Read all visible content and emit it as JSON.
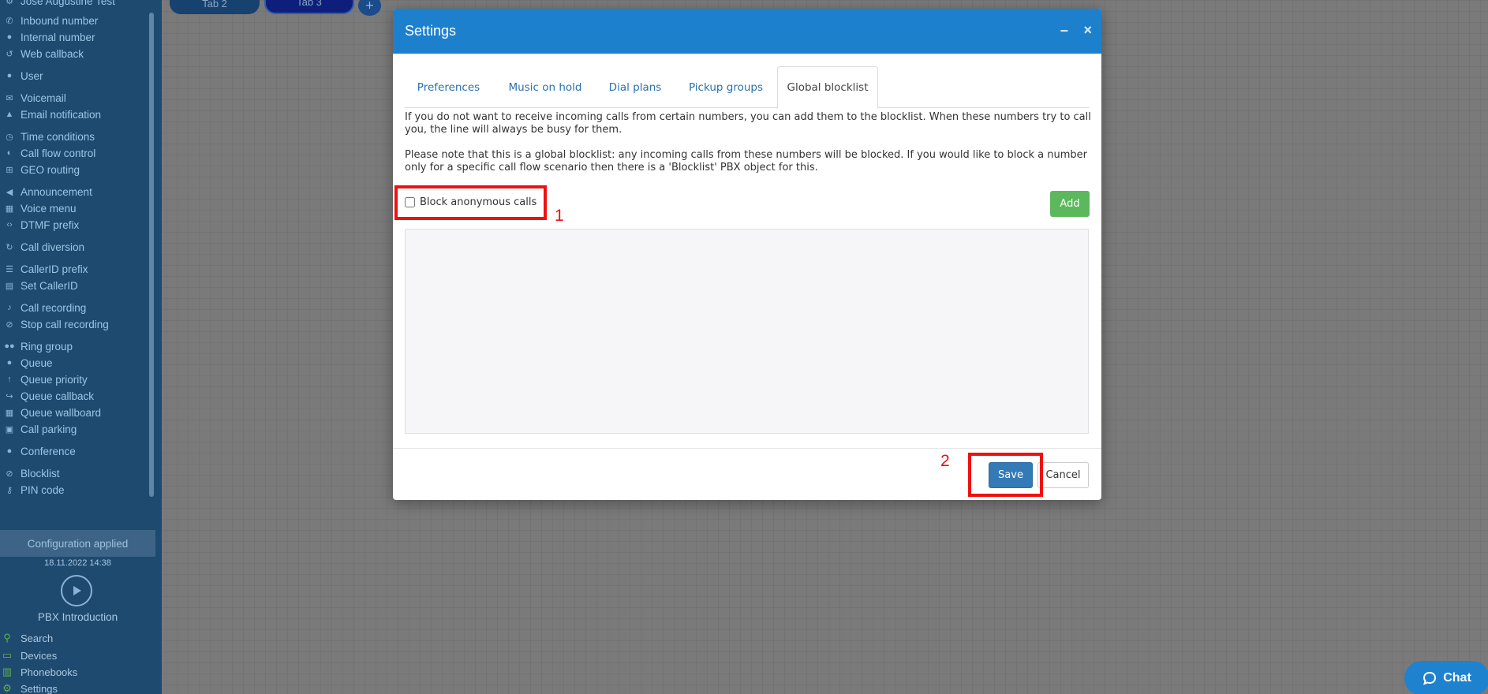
{
  "sidebar": {
    "items": [
      {
        "label": "Jose Augustine Test",
        "icon": "gear-icon"
      },
      {
        "label": "Inbound number",
        "icon": "phone-in-icon"
      },
      {
        "label": "Internal number",
        "icon": "pin-icon"
      },
      {
        "label": "Web callback",
        "icon": "callback-icon"
      },
      {
        "label": "User",
        "icon": "user-icon"
      },
      {
        "label": "Voicemail",
        "icon": "mail-icon"
      },
      {
        "label": "Email notification",
        "icon": "bell-icon"
      },
      {
        "label": "Time conditions",
        "icon": "clock-icon"
      },
      {
        "label": "Call flow control",
        "icon": "toggle-icon"
      },
      {
        "label": "GEO routing",
        "icon": "sitemap-icon"
      },
      {
        "label": "Announcement",
        "icon": "megaphone-icon"
      },
      {
        "label": "Voice menu",
        "icon": "grid-icon"
      },
      {
        "label": "DTMF prefix",
        "icon": "code-icon"
      },
      {
        "label": "Call diversion",
        "icon": "redo-icon"
      },
      {
        "label": "CallerID prefix",
        "icon": "list-icon"
      },
      {
        "label": "Set CallerID",
        "icon": "card-icon"
      },
      {
        "label": "Call recording",
        "icon": "mic-icon"
      },
      {
        "label": "Stop call recording",
        "icon": "mic-off-icon"
      },
      {
        "label": "Ring group",
        "icon": "users-icon"
      },
      {
        "label": "Queue",
        "icon": "user-icon"
      },
      {
        "label": "Queue priority",
        "icon": "arrow-up-icon"
      },
      {
        "label": "Queue callback",
        "icon": "share-icon"
      },
      {
        "label": "Queue wallboard",
        "icon": "table-icon"
      },
      {
        "label": "Call parking",
        "icon": "parking-icon"
      },
      {
        "label": "Conference",
        "icon": "chat-icon"
      },
      {
        "label": "Blocklist",
        "icon": "ban-icon"
      },
      {
        "label": "PIN code",
        "icon": "key-icon"
      }
    ],
    "config_status": "Configuration applied",
    "config_time": "18.11.2022 14:38",
    "intro_label": "PBX Introduction",
    "bottom": [
      {
        "label": "Search",
        "icon": "search-icon"
      },
      {
        "label": "Devices",
        "icon": "monitor-icon"
      },
      {
        "label": "Phonebooks",
        "icon": "book-icon"
      },
      {
        "label": "Settings",
        "icon": "gear-icon"
      }
    ]
  },
  "top_tabs": {
    "tab2": "Tab 2",
    "tab3": "Tab 3",
    "add": "+"
  },
  "modal": {
    "title": "Settings",
    "minimize": "−",
    "close": "×",
    "tabs": [
      "Preferences",
      "Music on hold",
      "Dial plans",
      "Pickup groups",
      "Global blocklist"
    ],
    "active_tab": "Global blocklist",
    "paragraph1": "If you do not want to receive incoming calls from certain numbers, you can add them to the blocklist. When these numbers try to call you, the line will always be busy for them.",
    "paragraph2": "Please note that this is a global blocklist: any incoming calls from these numbers will be blocked. If you would like to block a number only for a specific call flow scenario then there is a 'Blocklist' PBX object for this.",
    "block_anonymous_label": "Block anonymous calls",
    "block_anonymous_checked": false,
    "add_label": "Add",
    "save_label": "Save",
    "cancel_label": "Cancel"
  },
  "annotations": {
    "marker1": "1",
    "marker2": "2",
    "color": "#ee1111"
  },
  "chat": {
    "label": "Chat",
    "icon": "chat-bubble-icon"
  },
  "colors": {
    "header": "#1d80cd",
    "save": "#337ab7",
    "add": "#5cb85c",
    "sidebar": "#1f4a70"
  }
}
